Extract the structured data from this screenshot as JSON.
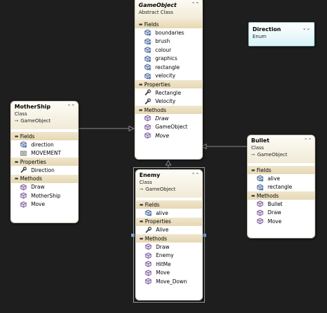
{
  "gameobject": {
    "title": "GameObject",
    "kind": "Abstract Class",
    "fields_label": "Fields",
    "fields": [
      "boundaries",
      "brush",
      "colour",
      "graphics",
      "rectangle",
      "velocity"
    ],
    "properties_label": "Properties",
    "properties": [
      "Rectangle",
      "Velocity"
    ],
    "methods_label": "Methods",
    "methods": [
      "Draw",
      "GameObject",
      "Move"
    ]
  },
  "direction": {
    "title": "Direction",
    "kind": "Enum"
  },
  "mothership": {
    "title": "MotherShip",
    "kind": "Class",
    "base": "GameObject",
    "fields_label": "Fields",
    "fields": [
      "direction",
      "MOVEMENT"
    ],
    "properties_label": "Properties",
    "properties": [
      "Direction"
    ],
    "methods_label": "Methods",
    "methods": [
      "Draw",
      "MotherShip",
      "Move"
    ]
  },
  "bullet": {
    "title": "Bullet",
    "kind": "Class",
    "base": "GameObject",
    "fields_label": "Fields",
    "fields": [
      "alive",
      "rectangle"
    ],
    "methods_label": "Methods",
    "methods": [
      "Bullet",
      "Draw",
      "Move"
    ]
  },
  "enemy": {
    "title": "Enemy",
    "kind": "Class",
    "base": "GameObject",
    "fields_label": "Fields",
    "fields": [
      "alive"
    ],
    "properties_label": "Properties",
    "properties": [
      "Alive"
    ],
    "methods_label": "Methods",
    "methods": [
      "Draw",
      "Enemy",
      "HitMe",
      "Move",
      "Move_Down"
    ]
  },
  "icons": {
    "field": "field-cube-icon",
    "const": "constant-icon",
    "property": "wrench-icon",
    "method": "method-cube-icon",
    "collapse": "double-chevron-icon",
    "base": "inheritance-arrow-icon"
  },
  "colors": {
    "canvas": "#1e1e1e",
    "header": "#f1ead6",
    "section": "#e6d8b4",
    "enum": "#d8f3f7",
    "wire": "#8a8a8a"
  }
}
